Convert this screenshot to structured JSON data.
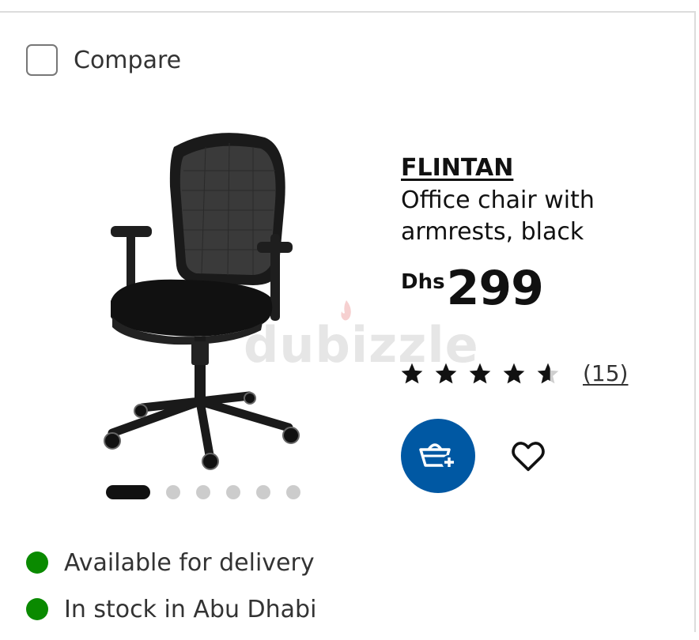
{
  "compare": {
    "label": "Compare",
    "checked": false
  },
  "product": {
    "name": "FLINTAN",
    "description": "Office chair with armrests, black",
    "currency": "Dhs",
    "price": "299",
    "rating": 4.5,
    "review_count": "(15)",
    "image_icon": "office-chair-image"
  },
  "carousel": {
    "total": 6,
    "active_index": 0
  },
  "actions": {
    "add_to_cart_icon": "basket-plus-icon",
    "wishlist_icon": "heart-icon"
  },
  "availability": [
    {
      "text": "Available for delivery",
      "status_color": "#0a8a00"
    },
    {
      "text": "In stock in Abu Dhabi",
      "status_color": "#0a8a00"
    }
  ],
  "watermark": {
    "text": "dubizzle"
  },
  "colors": {
    "accent": "#0058a3",
    "available": "#0a8a00"
  }
}
